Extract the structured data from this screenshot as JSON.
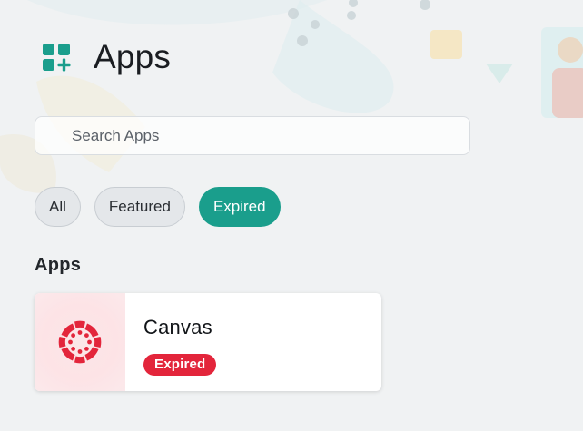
{
  "header": {
    "title": "Apps",
    "icon": "apps-grid-add-icon",
    "accent_color": "#1a9e8c"
  },
  "search": {
    "placeholder": "Search Apps",
    "value": ""
  },
  "filters": {
    "items": [
      {
        "label": "All",
        "active": false
      },
      {
        "label": "Featured",
        "active": false
      },
      {
        "label": "Expired",
        "active": true
      }
    ]
  },
  "section": {
    "title": "Apps"
  },
  "apps": [
    {
      "name": "Canvas",
      "logo": "canvas-logo-icon",
      "status": "Expired",
      "status_color": "#e3253b",
      "brand_color": "#e3253b"
    }
  ]
}
